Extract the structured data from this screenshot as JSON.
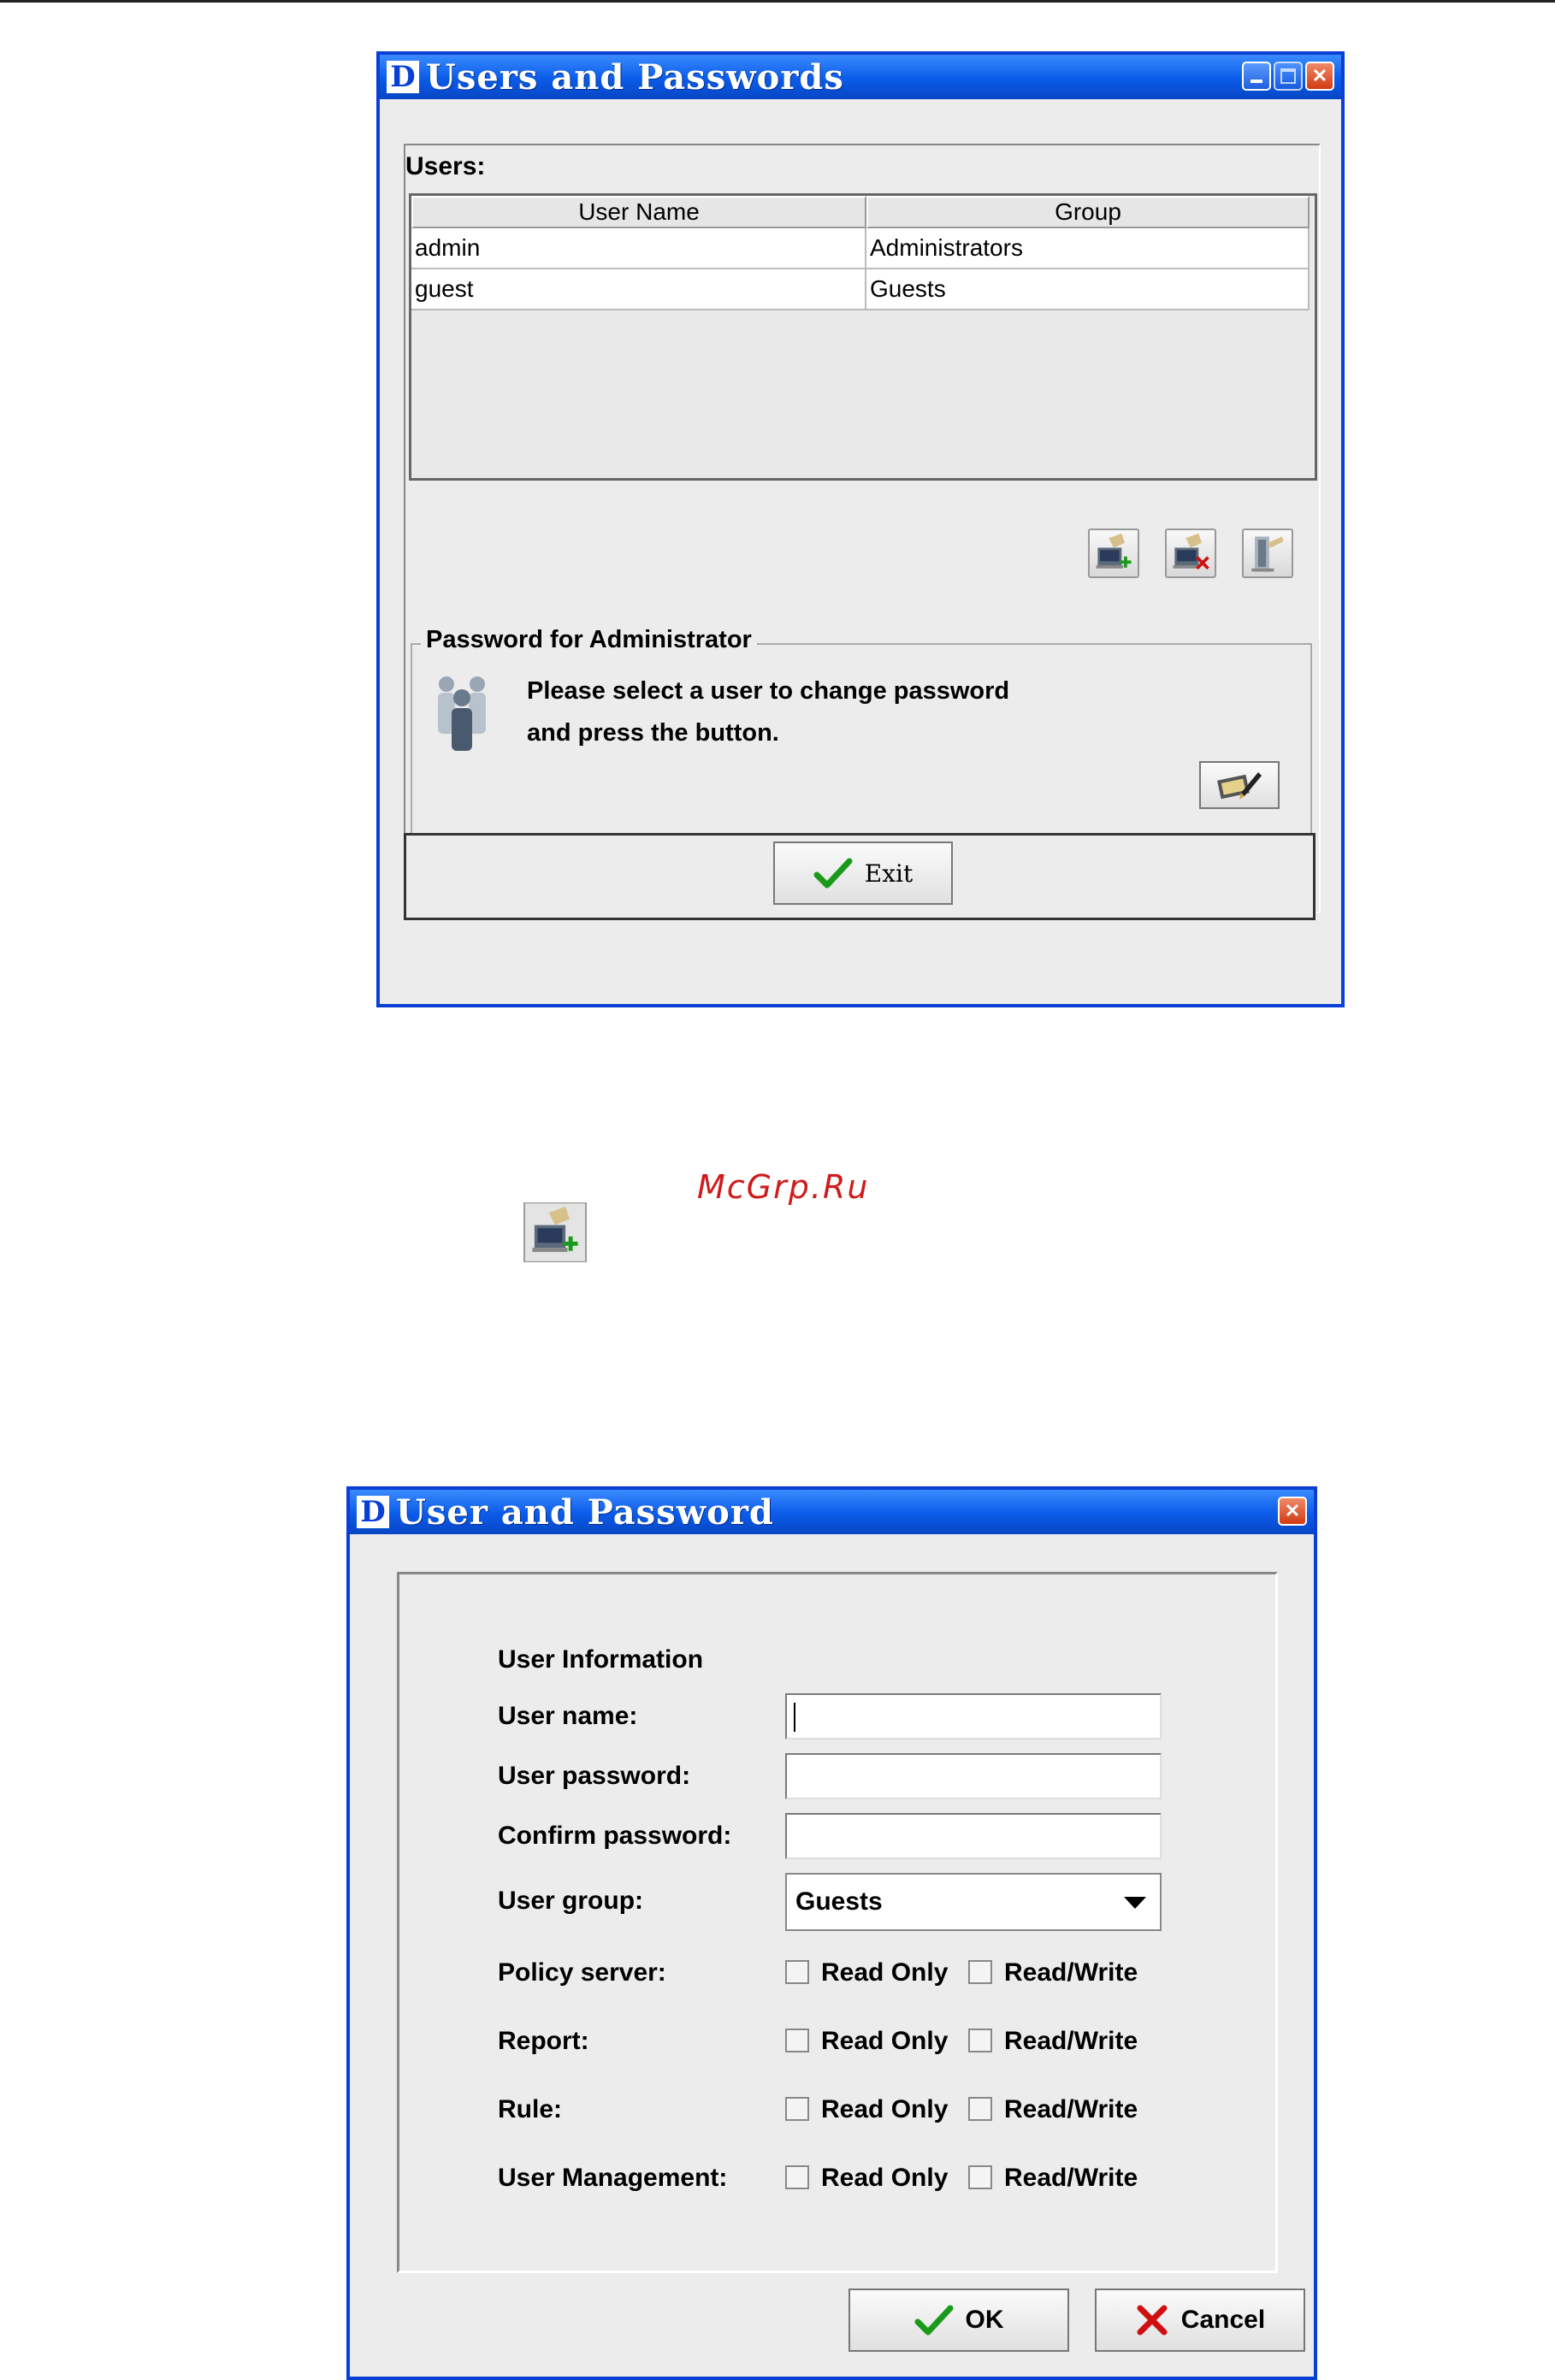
{
  "users_window": {
    "title": "Users and Passwords",
    "users_label": "Users:",
    "columns": [
      "User Name",
      "Group"
    ],
    "rows": [
      {
        "user": "admin",
        "group": "Administrators"
      },
      {
        "user": "guest",
        "group": "Guests"
      }
    ],
    "password_group_label": "Password for Administrator",
    "message_line1": "Please select a user to change password",
    "message_line2": "and press the button.",
    "exit_label": "Exit"
  },
  "watermark": "McGrp.Ru",
  "user_window": {
    "title": "User and Password",
    "section_title": "User Information",
    "labels": {
      "user_name": "User name:",
      "user_password": "User password:",
      "confirm_password": "Confirm password:",
      "user_group": "User group:"
    },
    "values": {
      "user_name": "",
      "user_password": "",
      "confirm_password": ""
    },
    "user_group_value": "Guests",
    "permissions": [
      {
        "label": "Policy server:"
      },
      {
        "label": "Report:"
      },
      {
        "label": "Rule:"
      },
      {
        "label": "User Management:"
      }
    ],
    "read_only_label": "Read Only",
    "read_write_label": "Read/Write",
    "ok_label": "OK",
    "cancel_label": "Cancel"
  },
  "colors": {
    "titlebar": "#0a5be8",
    "window_border": "#0a3fd6",
    "window_bg": "#ececec",
    "ok_check": "#1a9a1a",
    "cancel_x": "#d01010",
    "watermark": "#cf1b1b"
  },
  "icons": [
    "add-user-icon",
    "delete-user-icon",
    "edit-user-icon",
    "users-group-icon",
    "change-password-icon",
    "check-icon",
    "cancel-x-icon"
  ]
}
